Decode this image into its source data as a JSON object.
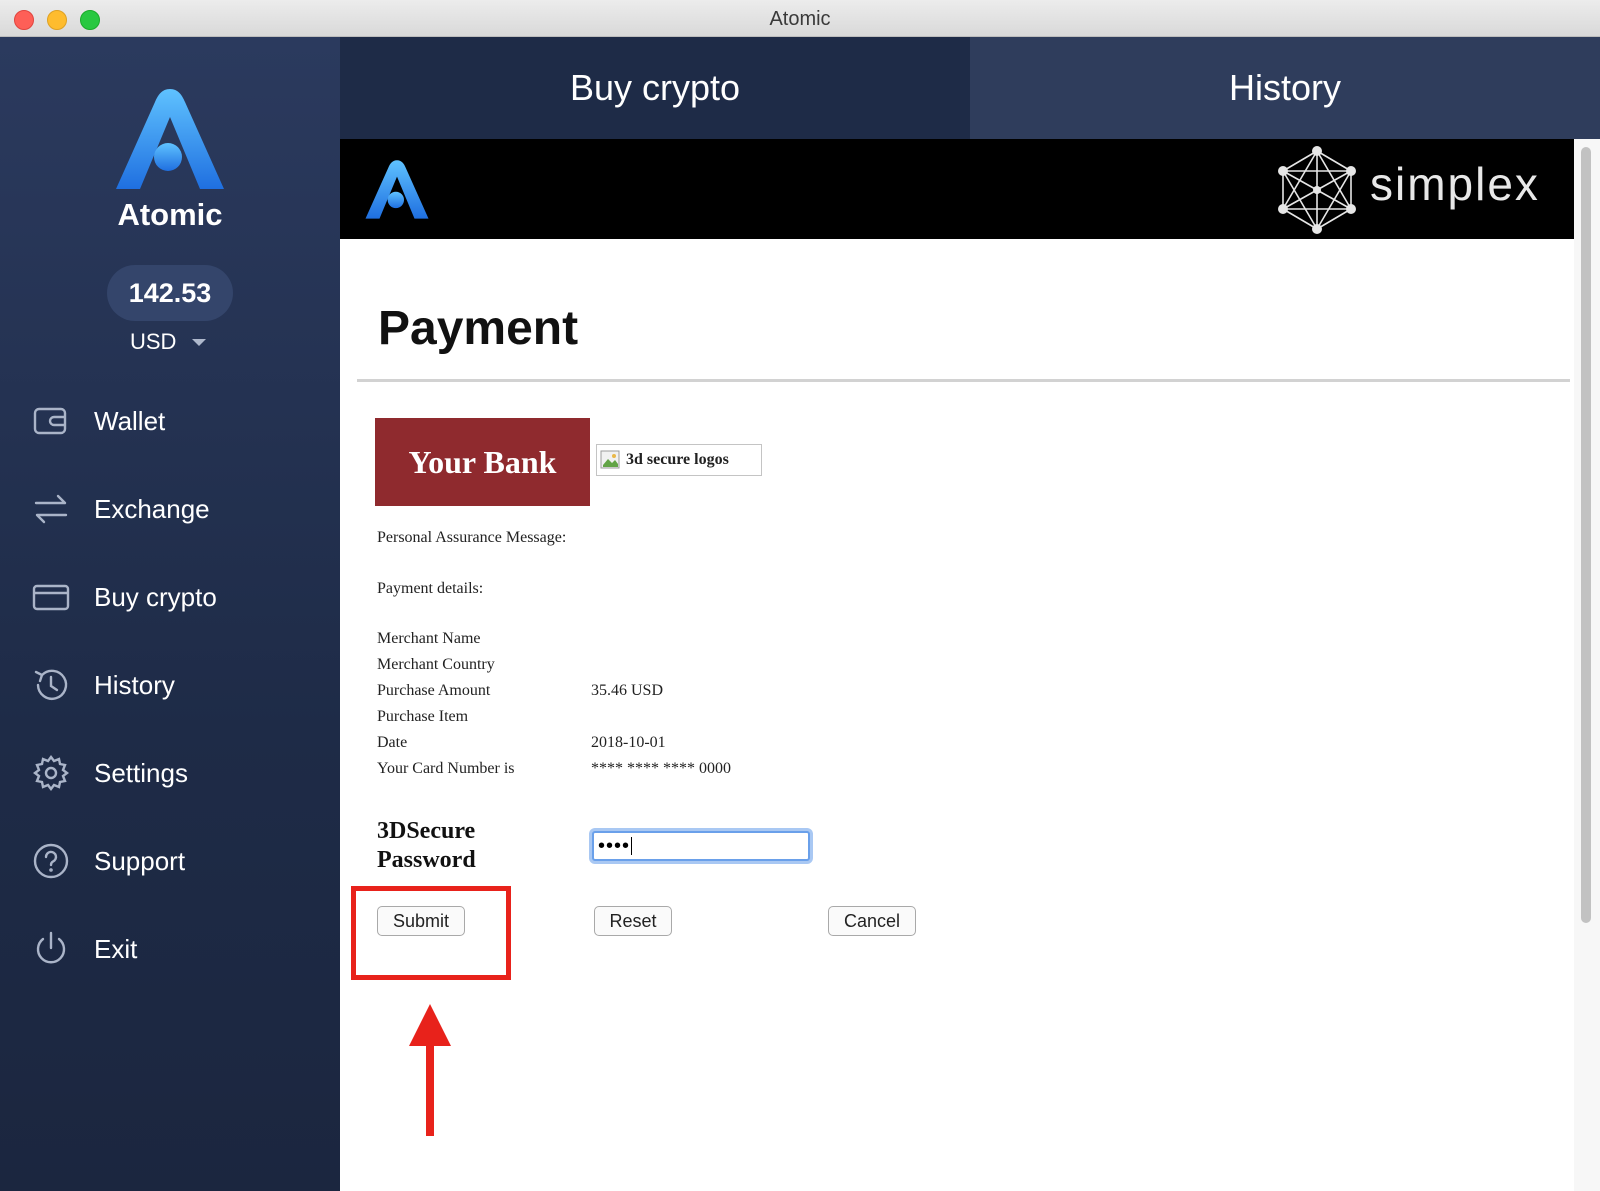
{
  "window": {
    "title": "Atomic"
  },
  "sidebar": {
    "brand": "Atomic",
    "balance": "142.53",
    "currency": "USD",
    "items": [
      {
        "label": "Wallet",
        "icon": "wallet-icon"
      },
      {
        "label": "Exchange",
        "icon": "exchange-icon"
      },
      {
        "label": "Buy crypto",
        "icon": "card-icon"
      },
      {
        "label": "History",
        "icon": "history-icon"
      },
      {
        "label": "Settings",
        "icon": "gear-icon"
      },
      {
        "label": "Support",
        "icon": "question-icon"
      },
      {
        "label": "Exit",
        "icon": "power-icon"
      }
    ]
  },
  "tabs": [
    {
      "label": "Buy crypto",
      "active": true
    },
    {
      "label": "History",
      "active": false
    }
  ],
  "banner": {
    "partner": "simplex"
  },
  "payment": {
    "title": "Payment",
    "bank_logo_text": "Your Bank",
    "secure_logos_alt": "3d secure logos",
    "pam_label": "Personal Assurance Message:",
    "details_label": "Payment details:",
    "details": [
      {
        "label": "Merchant Name",
        "value": ""
      },
      {
        "label": "Merchant Country",
        "value": ""
      },
      {
        "label": "Purchase Amount",
        "value": "35.46 USD"
      },
      {
        "label": "Purchase Item",
        "value": ""
      },
      {
        "label": "Date",
        "value": "2018-10-01"
      },
      {
        "label": "Your Card Number is",
        "value": "**** **** **** 0000"
      }
    ],
    "password_label_line1": "3DSecure",
    "password_label_line2": "Password",
    "password_value": "••••",
    "buttons": {
      "submit": "Submit",
      "reset": "Reset",
      "cancel": "Cancel"
    }
  },
  "colors": {
    "sidebar_bg": "#1e2b47",
    "accent_blue": "#2f8cf0",
    "bank_red": "#8f2a2e",
    "annotation_red": "#e8221b"
  }
}
